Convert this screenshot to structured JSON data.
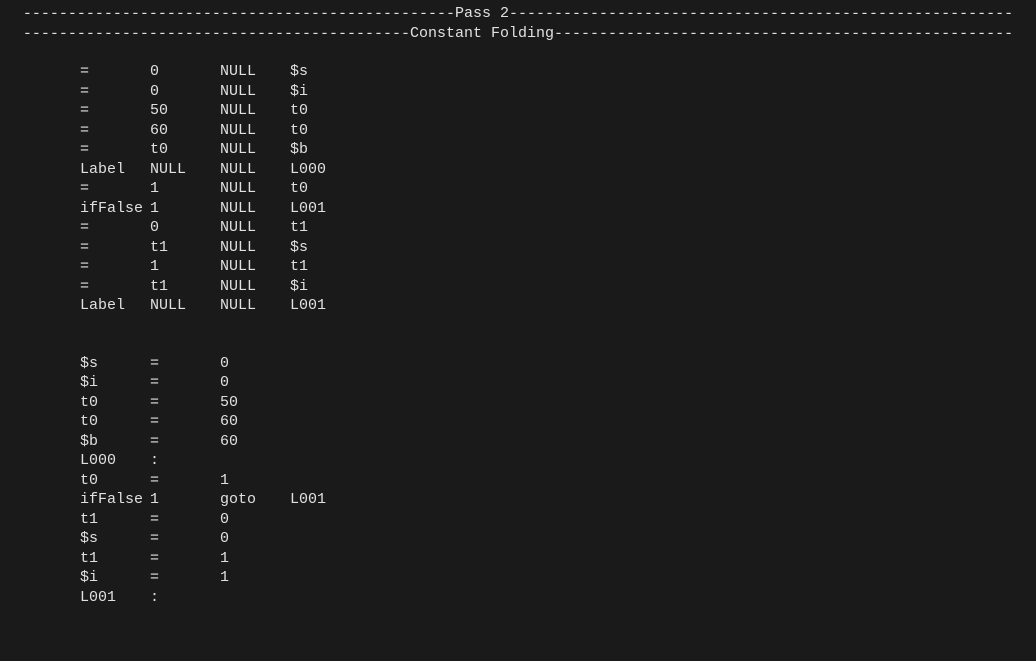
{
  "header1": {
    "text": "Pass 2",
    "dash_left": "------------------------------------------------",
    "dash_right": "--------------------------------------------------------"
  },
  "header2": {
    "text": "Constant Folding",
    "dash_left": "-------------------------------------------",
    "dash_right": "---------------------------------------------------"
  },
  "table1": {
    "rows": [
      {
        "c1": "=",
        "c2": "0",
        "c3": "NULL",
        "c4": "$s"
      },
      {
        "c1": "=",
        "c2": "0",
        "c3": "NULL",
        "c4": "$i"
      },
      {
        "c1": "=",
        "c2": "50",
        "c3": "NULL",
        "c4": "t0"
      },
      {
        "c1": "=",
        "c2": "60",
        "c3": "NULL",
        "c4": "t0"
      },
      {
        "c1": "=",
        "c2": "t0",
        "c3": "NULL",
        "c4": "$b"
      },
      {
        "c1": "Label",
        "c2": "NULL",
        "c3": "NULL",
        "c4": "L000"
      },
      {
        "c1": "=",
        "c2": "1",
        "c3": "NULL",
        "c4": "t0"
      },
      {
        "c1": "ifFalse",
        "c2": "1",
        "c3": "NULL",
        "c4": "L001"
      },
      {
        "c1": "=",
        "c2": "0",
        "c3": "NULL",
        "c4": "t1"
      },
      {
        "c1": "=",
        "c2": "t1",
        "c3": "NULL",
        "c4": "$s"
      },
      {
        "c1": "=",
        "c2": "1",
        "c3": "NULL",
        "c4": "t1"
      },
      {
        "c1": "=",
        "c2": "t1",
        "c3": "NULL",
        "c4": "$i"
      },
      {
        "c1": "Label",
        "c2": "NULL",
        "c3": "NULL",
        "c4": "L001"
      }
    ]
  },
  "table2": {
    "rows": [
      {
        "c1": "$s",
        "c2": "=",
        "c3": "0",
        "c4": ""
      },
      {
        "c1": "$i",
        "c2": "=",
        "c3": "0",
        "c4": ""
      },
      {
        "c1": "t0",
        "c2": "=",
        "c3": "50",
        "c4": ""
      },
      {
        "c1": "t0",
        "c2": "=",
        "c3": "60",
        "c4": ""
      },
      {
        "c1": "$b",
        "c2": "=",
        "c3": "60",
        "c4": ""
      },
      {
        "c1": "L000",
        "c2": ":",
        "c3": "",
        "c4": ""
      },
      {
        "c1": "t0",
        "c2": "=",
        "c3": "1",
        "c4": ""
      },
      {
        "c1": "ifFalse",
        "c2": "1",
        "c3": "goto",
        "c4": "L001"
      },
      {
        "c1": "t1",
        "c2": "=",
        "c3": "0",
        "c4": ""
      },
      {
        "c1": "$s",
        "c2": "=",
        "c3": "0",
        "c4": ""
      },
      {
        "c1": "t1",
        "c2": "=",
        "c3": "1",
        "c4": ""
      },
      {
        "c1": "$i",
        "c2": "=",
        "c3": "1",
        "c4": ""
      },
      {
        "c1": "L001",
        "c2": ":",
        "c3": "",
        "c4": ""
      }
    ]
  }
}
